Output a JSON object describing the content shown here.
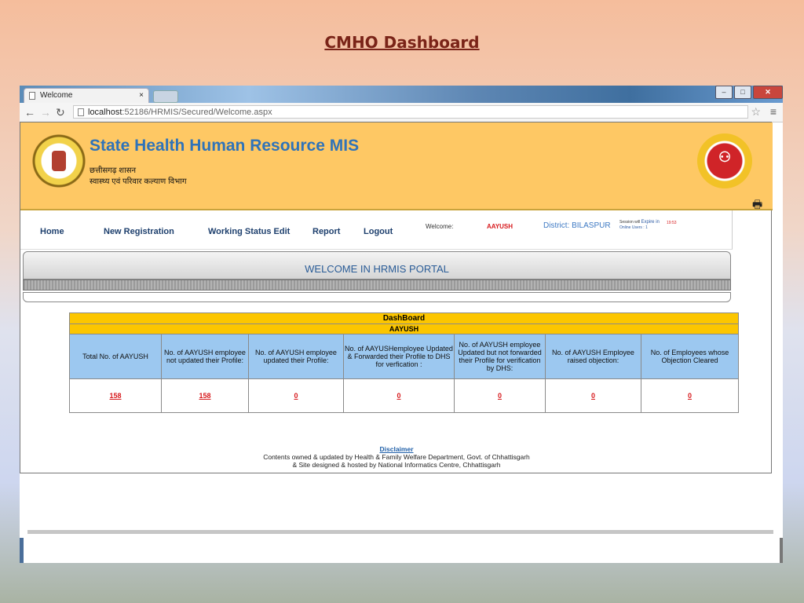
{
  "slide": {
    "title": "CMHO Dashboard"
  },
  "browser": {
    "tab_title": "Welcome",
    "tab_close": "×",
    "url_host": "localhost",
    "url_rest": ":52186/HRMIS/Secured/Welcome.aspx"
  },
  "header": {
    "title": "State Health Human Resource MIS",
    "sub1": "छत्तीसगढ़ शासन",
    "sub2": "स्वास्थ्य एवं परिवार कल्याण विभाग"
  },
  "nav": {
    "home": "Home",
    "new_registration": "New Registration",
    "working_status_edit": "Working Status Edit",
    "report": "Report",
    "logout": "Logout",
    "welcome_label": "Welcome:",
    "user": "AAYUSH",
    "district": "District: BILASPUR",
    "session_prefix": "Session will",
    "session_expire": "Expire in",
    "online_users": "Online Users : 1",
    "timer": "19:53"
  },
  "banner": {
    "text": "WELCOME IN HRMIS PORTAL"
  },
  "dashboard": {
    "title": "DashBoard",
    "subtitle": "AAYUSH",
    "headers": [
      "Total No. of AAYUSH",
      "No. of  AAYUSH employee not  updated their Profile:",
      "No. of AAYUSH employee updated their Profile:",
      "No. of AAYUSHemployee Updated & Forwarded their Profile to DHS for verfication :",
      "No. of AAYUSH employee Updated but  not forwarded their Profile for verification by DHS:",
      "No. of AAYUSH Employee raised objection:",
      "No. of Employees whose Objection Cleared"
    ],
    "values": [
      "158",
      "158",
      "0",
      "0",
      "0",
      "0",
      "0"
    ]
  },
  "footer": {
    "disclaimer": "Disclaimer",
    "line1": "Contents owned & updated by Health & Family Welfare Department, Govt. of Chhattisgarh",
    "line2": "& Site designed & hosted by National Informatics Centre, Chhattisgarh"
  }
}
